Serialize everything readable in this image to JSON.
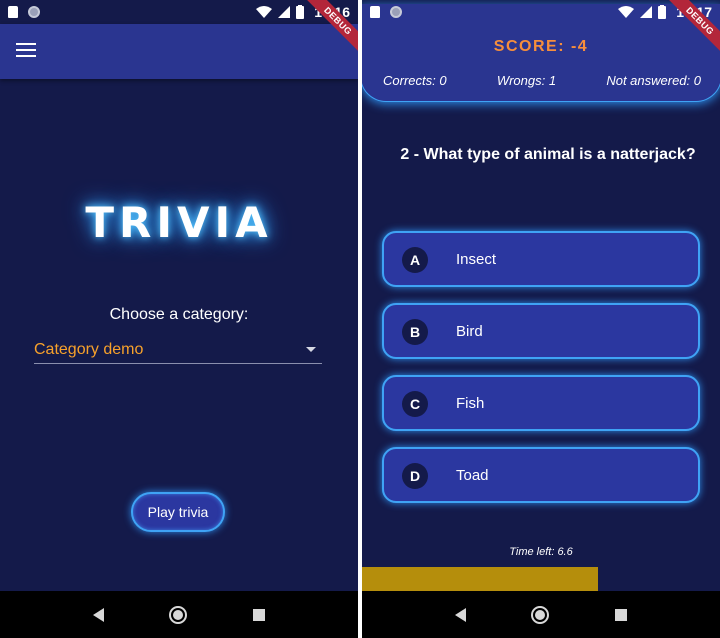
{
  "left": {
    "status_time": "10:16",
    "debug_label": "DEBUG",
    "title": "TRIVIA",
    "choose_label": "Choose a category:",
    "category_value": "Category demo",
    "play_button": "Play trivia"
  },
  "right": {
    "status_time": "10:17",
    "debug_label": "DEBUG",
    "score": "SCORE: -4",
    "corrects": "Corrects: 0",
    "wrongs": "Wrongs: 1",
    "not_answered": "Not answered: 0",
    "question": "2 - What type of animal is a natterjack?",
    "answers": [
      {
        "letter": "A",
        "text": "Insect"
      },
      {
        "letter": "B",
        "text": "Bird"
      },
      {
        "letter": "C",
        "text": "Fish"
      },
      {
        "letter": "D",
        "text": "Toad"
      }
    ],
    "time_left": "Time left: 6.6",
    "time_left_fraction": 0.66
  },
  "colors": {
    "background": "#141a4a",
    "appbar": "#2a3590",
    "accent_orange": "#f7a12b",
    "glow_blue": "#3fa3f5",
    "timer_bar": "#b58e0c"
  },
  "icons": [
    "sd-card-icon",
    "sync-icon",
    "wifi-icon",
    "cell-signal-icon",
    "battery-icon",
    "menu-icon",
    "dropdown-caret-icon",
    "back-icon",
    "home-icon",
    "recents-icon"
  ]
}
